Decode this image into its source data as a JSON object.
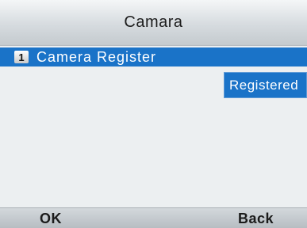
{
  "header": {
    "title": "Camara"
  },
  "menu": {
    "items": [
      {
        "index": "1",
        "label": "Camera Register",
        "status": "Registered"
      }
    ]
  },
  "softkeys": {
    "left": "OK",
    "right": "Back"
  },
  "colors": {
    "accent": "#1a73c8",
    "background": "#eceff1",
    "bar": "#c4cace"
  }
}
